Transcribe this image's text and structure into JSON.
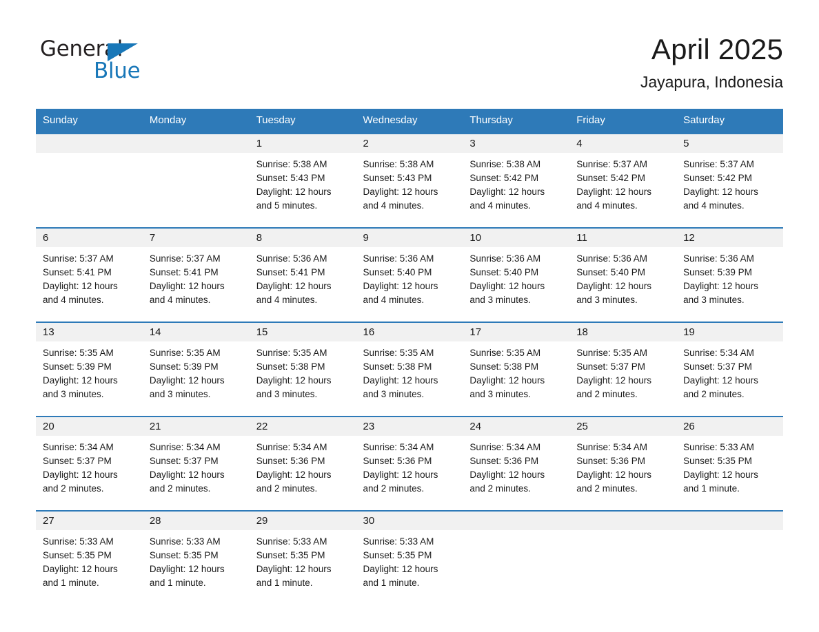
{
  "logo": {
    "word_one": "General",
    "word_two": "Blue",
    "triangle_icon": "triangle-icon",
    "accent_color": "#1877b8"
  },
  "header": {
    "month_title": "April 2025",
    "location": "Jayapura, Indonesia"
  },
  "theme": {
    "header_blue": "#2e7ab8",
    "daynum_band": "#f1f1f1",
    "page_background": "#ffffff",
    "text_color": "#1a1a1a"
  },
  "calendar": {
    "weekday_headers": [
      "Sunday",
      "Monday",
      "Tuesday",
      "Wednesday",
      "Thursday",
      "Friday",
      "Saturday"
    ],
    "weeks": [
      [
        {
          "day": "",
          "lines": []
        },
        {
          "day": "",
          "lines": []
        },
        {
          "day": "1",
          "lines": [
            "Sunrise: 5:38 AM",
            "Sunset: 5:43 PM",
            "Daylight: 12 hours",
            "and 5 minutes."
          ]
        },
        {
          "day": "2",
          "lines": [
            "Sunrise: 5:38 AM",
            "Sunset: 5:43 PM",
            "Daylight: 12 hours",
            "and 4 minutes."
          ]
        },
        {
          "day": "3",
          "lines": [
            "Sunrise: 5:38 AM",
            "Sunset: 5:42 PM",
            "Daylight: 12 hours",
            "and 4 minutes."
          ]
        },
        {
          "day": "4",
          "lines": [
            "Sunrise: 5:37 AM",
            "Sunset: 5:42 PM",
            "Daylight: 12 hours",
            "and 4 minutes."
          ]
        },
        {
          "day": "5",
          "lines": [
            "Sunrise: 5:37 AM",
            "Sunset: 5:42 PM",
            "Daylight: 12 hours",
            "and 4 minutes."
          ]
        }
      ],
      [
        {
          "day": "6",
          "lines": [
            "Sunrise: 5:37 AM",
            "Sunset: 5:41 PM",
            "Daylight: 12 hours",
            "and 4 minutes."
          ]
        },
        {
          "day": "7",
          "lines": [
            "Sunrise: 5:37 AM",
            "Sunset: 5:41 PM",
            "Daylight: 12 hours",
            "and 4 minutes."
          ]
        },
        {
          "day": "8",
          "lines": [
            "Sunrise: 5:36 AM",
            "Sunset: 5:41 PM",
            "Daylight: 12 hours",
            "and 4 minutes."
          ]
        },
        {
          "day": "9",
          "lines": [
            "Sunrise: 5:36 AM",
            "Sunset: 5:40 PM",
            "Daylight: 12 hours",
            "and 4 minutes."
          ]
        },
        {
          "day": "10",
          "lines": [
            "Sunrise: 5:36 AM",
            "Sunset: 5:40 PM",
            "Daylight: 12 hours",
            "and 3 minutes."
          ]
        },
        {
          "day": "11",
          "lines": [
            "Sunrise: 5:36 AM",
            "Sunset: 5:40 PM",
            "Daylight: 12 hours",
            "and 3 minutes."
          ]
        },
        {
          "day": "12",
          "lines": [
            "Sunrise: 5:36 AM",
            "Sunset: 5:39 PM",
            "Daylight: 12 hours",
            "and 3 minutes."
          ]
        }
      ],
      [
        {
          "day": "13",
          "lines": [
            "Sunrise: 5:35 AM",
            "Sunset: 5:39 PM",
            "Daylight: 12 hours",
            "and 3 minutes."
          ]
        },
        {
          "day": "14",
          "lines": [
            "Sunrise: 5:35 AM",
            "Sunset: 5:39 PM",
            "Daylight: 12 hours",
            "and 3 minutes."
          ]
        },
        {
          "day": "15",
          "lines": [
            "Sunrise: 5:35 AM",
            "Sunset: 5:38 PM",
            "Daylight: 12 hours",
            "and 3 minutes."
          ]
        },
        {
          "day": "16",
          "lines": [
            "Sunrise: 5:35 AM",
            "Sunset: 5:38 PM",
            "Daylight: 12 hours",
            "and 3 minutes."
          ]
        },
        {
          "day": "17",
          "lines": [
            "Sunrise: 5:35 AM",
            "Sunset: 5:38 PM",
            "Daylight: 12 hours",
            "and 3 minutes."
          ]
        },
        {
          "day": "18",
          "lines": [
            "Sunrise: 5:35 AM",
            "Sunset: 5:37 PM",
            "Daylight: 12 hours",
            "and 2 minutes."
          ]
        },
        {
          "day": "19",
          "lines": [
            "Sunrise: 5:34 AM",
            "Sunset: 5:37 PM",
            "Daylight: 12 hours",
            "and 2 minutes."
          ]
        }
      ],
      [
        {
          "day": "20",
          "lines": [
            "Sunrise: 5:34 AM",
            "Sunset: 5:37 PM",
            "Daylight: 12 hours",
            "and 2 minutes."
          ]
        },
        {
          "day": "21",
          "lines": [
            "Sunrise: 5:34 AM",
            "Sunset: 5:37 PM",
            "Daylight: 12 hours",
            "and 2 minutes."
          ]
        },
        {
          "day": "22",
          "lines": [
            "Sunrise: 5:34 AM",
            "Sunset: 5:36 PM",
            "Daylight: 12 hours",
            "and 2 minutes."
          ]
        },
        {
          "day": "23",
          "lines": [
            "Sunrise: 5:34 AM",
            "Sunset: 5:36 PM",
            "Daylight: 12 hours",
            "and 2 minutes."
          ]
        },
        {
          "day": "24",
          "lines": [
            "Sunrise: 5:34 AM",
            "Sunset: 5:36 PM",
            "Daylight: 12 hours",
            "and 2 minutes."
          ]
        },
        {
          "day": "25",
          "lines": [
            "Sunrise: 5:34 AM",
            "Sunset: 5:36 PM",
            "Daylight: 12 hours",
            "and 2 minutes."
          ]
        },
        {
          "day": "26",
          "lines": [
            "Sunrise: 5:33 AM",
            "Sunset: 5:35 PM",
            "Daylight: 12 hours",
            "and 1 minute."
          ]
        }
      ],
      [
        {
          "day": "27",
          "lines": [
            "Sunrise: 5:33 AM",
            "Sunset: 5:35 PM",
            "Daylight: 12 hours",
            "and 1 minute."
          ]
        },
        {
          "day": "28",
          "lines": [
            "Sunrise: 5:33 AM",
            "Sunset: 5:35 PM",
            "Daylight: 12 hours",
            "and 1 minute."
          ]
        },
        {
          "day": "29",
          "lines": [
            "Sunrise: 5:33 AM",
            "Sunset: 5:35 PM",
            "Daylight: 12 hours",
            "and 1 minute."
          ]
        },
        {
          "day": "30",
          "lines": [
            "Sunrise: 5:33 AM",
            "Sunset: 5:35 PM",
            "Daylight: 12 hours",
            "and 1 minute."
          ]
        },
        {
          "day": "",
          "lines": []
        },
        {
          "day": "",
          "lines": []
        },
        {
          "day": "",
          "lines": []
        }
      ]
    ]
  }
}
